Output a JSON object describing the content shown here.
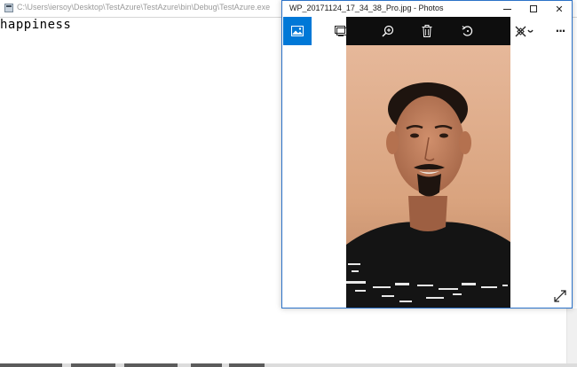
{
  "console": {
    "title": "C:\\Users\\iersoy\\Desktop\\TestAzure\\TestAzure\\bin\\Debug\\TestAzure.exe",
    "output": "happiness",
    "icon": "console-app-icon"
  },
  "photos": {
    "title": "WP_20171124_17_34_38_Pro.jpg - Photos",
    "window_buttons": {
      "minimize": "minimize-icon",
      "maximize": "maximize-icon",
      "close": "✕"
    },
    "toolbar": {
      "collection": "image-icon",
      "slideshow": "slideshow-icon",
      "zoom": "zoom-in-icon",
      "delete": "trash-icon",
      "rotate": "rotate-icon",
      "edit": "edit-create-icon",
      "more": "···"
    },
    "expand": "expand-icon",
    "accent_color": "#0078d7"
  }
}
